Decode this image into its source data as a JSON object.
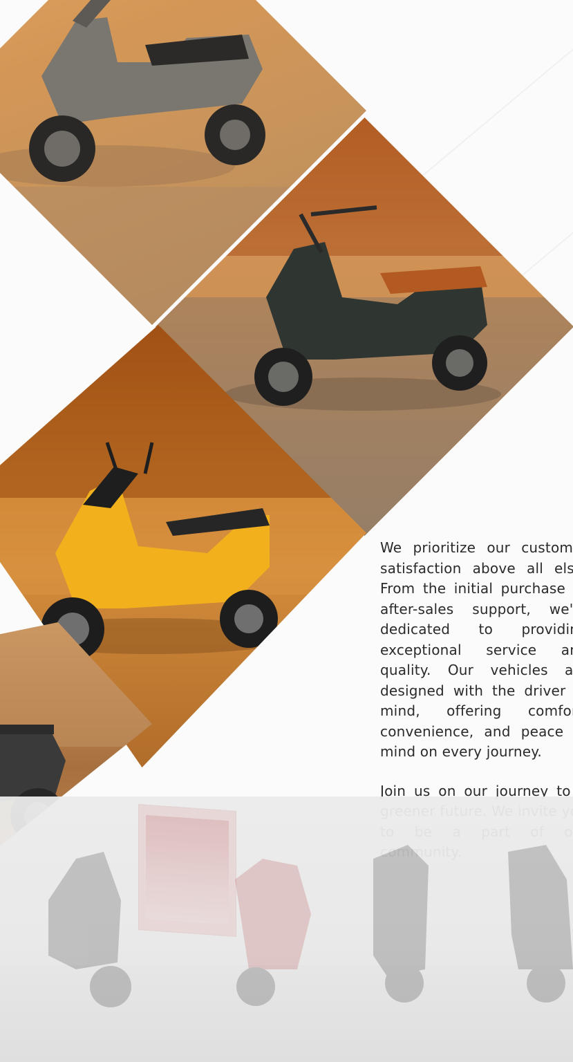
{
  "about": {
    "paragraph1": "We prioritize our customer satisfaction above all else. From the initial purchase to after-sales support, we're dedicated to providing exceptional service and quality. Our vehicles are designed with the driver in mind, offering comfort, convenience, and peace of mind on every journey.",
    "paragraph2": "Join us on our journey to a greener future. We invite you to be a part of our community."
  },
  "images": [
    {
      "name": "scooter-photo-grey",
      "description": "Grey electric scooter parked on road"
    },
    {
      "name": "scooter-photo-black-orange-seat",
      "description": "Dark scooter with orange seat riding"
    },
    {
      "name": "scooter-photo-yellow",
      "description": "Yellow electric scooter in motion"
    },
    {
      "name": "scooter-photo-black-retro",
      "description": "Black retro style scooter"
    },
    {
      "name": "showroom-photo",
      "description": "Showroom with several scooters"
    }
  ],
  "colors": {
    "tile_overlay": "#d3954f",
    "text": "#2a2a2a",
    "background": "#fbfbfb"
  }
}
